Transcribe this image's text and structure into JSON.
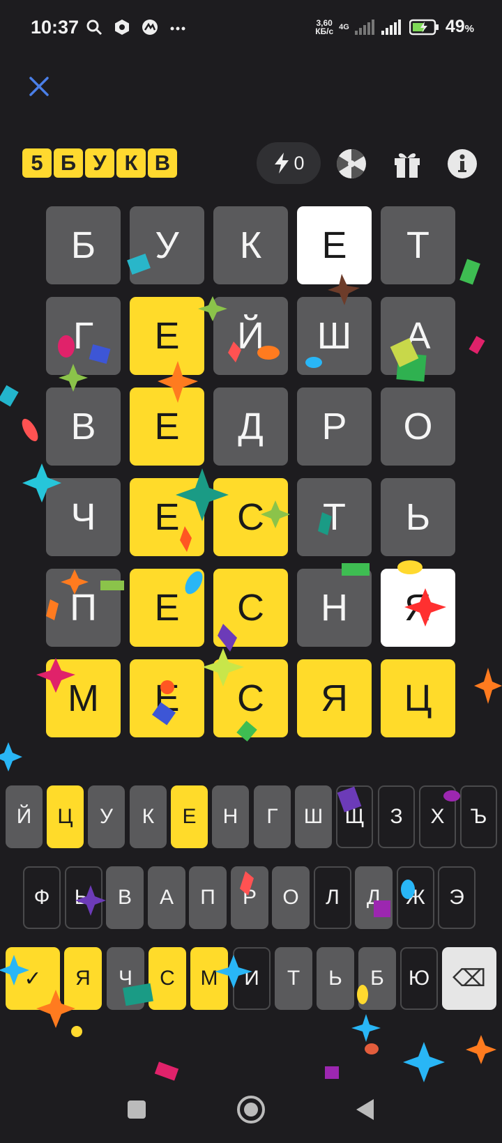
{
  "status_bar": {
    "time": "10:37",
    "speed_value": "3,60",
    "speed_unit": "КБ/с",
    "network": "4G",
    "battery": "49",
    "battery_unit": "%"
  },
  "logo": [
    "5",
    "Б",
    "У",
    "К",
    "В"
  ],
  "hints": {
    "count": "0"
  },
  "board": [
    [
      {
        "l": "Б",
        "s": "gray"
      },
      {
        "l": "У",
        "s": "gray"
      },
      {
        "l": "К",
        "s": "gray"
      },
      {
        "l": "Е",
        "s": "white"
      },
      {
        "l": "Т",
        "s": "gray"
      }
    ],
    [
      {
        "l": "Г",
        "s": "gray"
      },
      {
        "l": "Е",
        "s": "yellow"
      },
      {
        "l": "Й",
        "s": "gray"
      },
      {
        "l": "Ш",
        "s": "gray"
      },
      {
        "l": "А",
        "s": "gray"
      }
    ],
    [
      {
        "l": "В",
        "s": "gray"
      },
      {
        "l": "Е",
        "s": "yellow"
      },
      {
        "l": "Д",
        "s": "gray"
      },
      {
        "l": "Р",
        "s": "gray"
      },
      {
        "l": "О",
        "s": "gray"
      }
    ],
    [
      {
        "l": "Ч",
        "s": "gray"
      },
      {
        "l": "Е",
        "s": "yellow"
      },
      {
        "l": "С",
        "s": "yellow"
      },
      {
        "l": "Т",
        "s": "gray"
      },
      {
        "l": "Ь",
        "s": "gray"
      }
    ],
    [
      {
        "l": "П",
        "s": "gray"
      },
      {
        "l": "Е",
        "s": "yellow"
      },
      {
        "l": "С",
        "s": "yellow"
      },
      {
        "l": "Н",
        "s": "gray"
      },
      {
        "l": "Я",
        "s": "white"
      }
    ],
    [
      {
        "l": "М",
        "s": "yellow"
      },
      {
        "l": "Е",
        "s": "yellow"
      },
      {
        "l": "С",
        "s": "yellow"
      },
      {
        "l": "Я",
        "s": "yellow"
      },
      {
        "l": "Ц",
        "s": "yellow"
      }
    ]
  ],
  "keyboard": {
    "row1": [
      {
        "l": "Й",
        "s": "unused"
      },
      {
        "l": "Ц",
        "s": "present"
      },
      {
        "l": "У",
        "s": "unused"
      },
      {
        "l": "К",
        "s": "unused"
      },
      {
        "l": "Е",
        "s": "present"
      },
      {
        "l": "Н",
        "s": "unused"
      },
      {
        "l": "Г",
        "s": "unused"
      },
      {
        "l": "Ш",
        "s": "unused"
      },
      {
        "l": "Щ",
        "s": "absent"
      },
      {
        "l": "З",
        "s": "absent"
      },
      {
        "l": "Х",
        "s": "absent"
      },
      {
        "l": "Ъ",
        "s": "absent"
      }
    ],
    "row2": [
      {
        "l": "Ф",
        "s": "absent"
      },
      {
        "l": "Ы",
        "s": "absent"
      },
      {
        "l": "В",
        "s": "unused"
      },
      {
        "l": "А",
        "s": "unused"
      },
      {
        "l": "П",
        "s": "unused"
      },
      {
        "l": "Р",
        "s": "unused"
      },
      {
        "l": "О",
        "s": "unused"
      },
      {
        "l": "Л",
        "s": "absent"
      },
      {
        "l": "Д",
        "s": "unused"
      },
      {
        "l": "Ж",
        "s": "absent"
      },
      {
        "l": "Э",
        "s": "absent"
      }
    ],
    "row3": [
      {
        "l": "✓",
        "s": "present"
      },
      {
        "l": "Я",
        "s": "present"
      },
      {
        "l": "Ч",
        "s": "unused"
      },
      {
        "l": "С",
        "s": "present"
      },
      {
        "l": "М",
        "s": "present"
      },
      {
        "l": "И",
        "s": "absent"
      },
      {
        "l": "Т",
        "s": "unused"
      },
      {
        "l": "Ь",
        "s": "unused"
      },
      {
        "l": "Б",
        "s": "unused"
      },
      {
        "l": "Ю",
        "s": "absent"
      },
      {
        "l": "⌫",
        "s": "special"
      }
    ]
  },
  "icons": {
    "close": "close-icon",
    "hint": "lightning-icon",
    "wheel": "wheel-icon",
    "gift": "gift-icon",
    "info": "info-icon"
  },
  "colors": {
    "present": "#ffdb2a",
    "unused": "#5a5a5c",
    "background": "#1d1c1f",
    "white_tile": "#ffffff"
  }
}
